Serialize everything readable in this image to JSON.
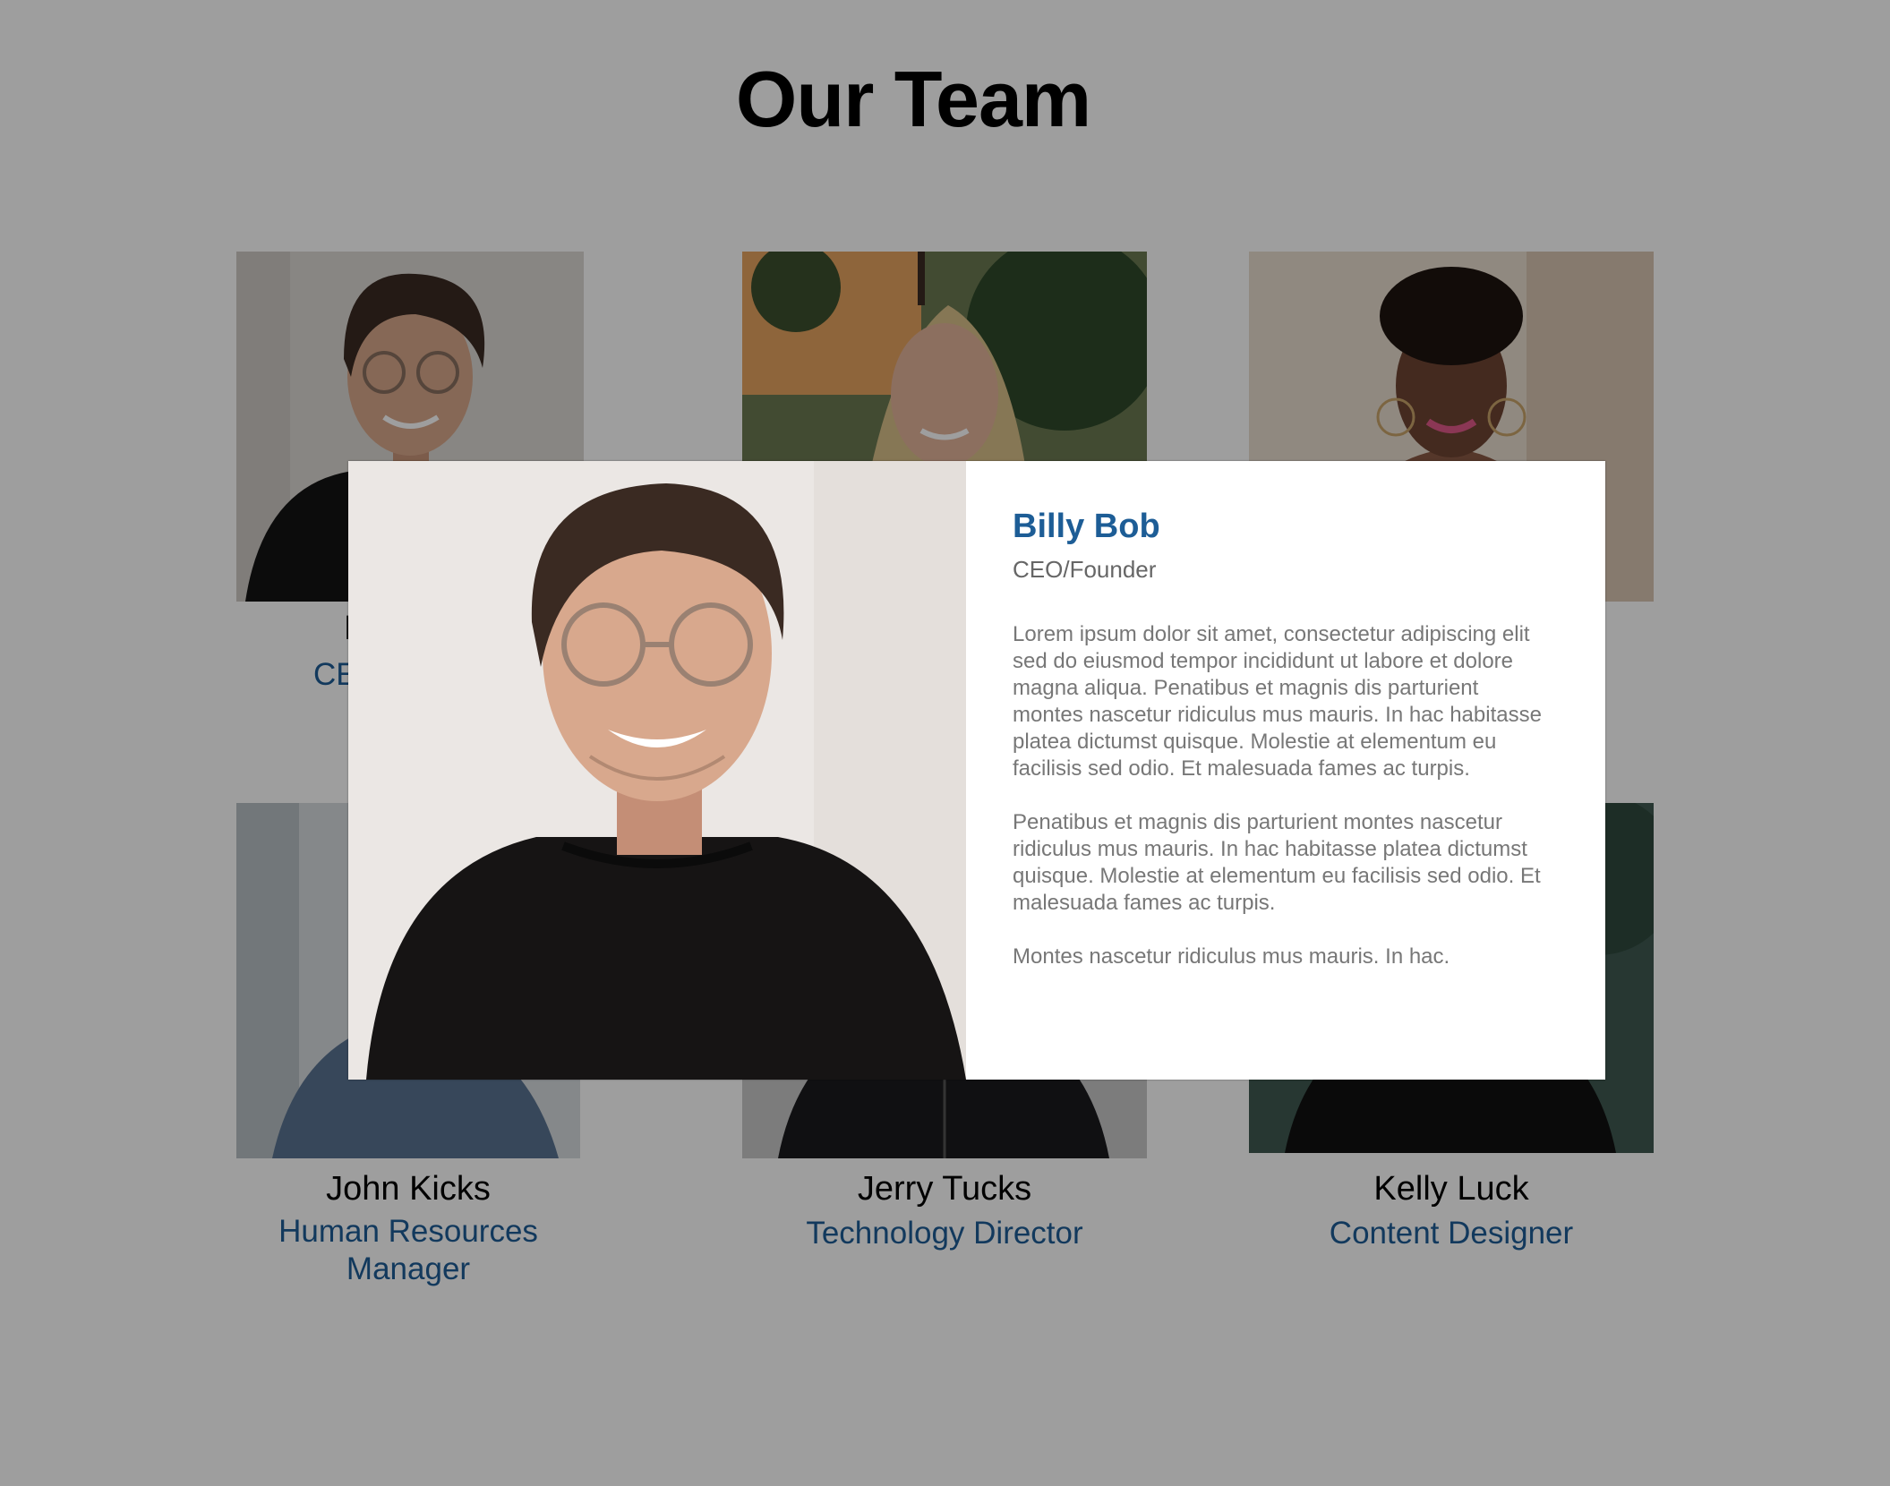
{
  "page": {
    "title": "Our Team"
  },
  "team": [
    {
      "name": "Billy Bob",
      "role": "CEO/Founder"
    },
    {
      "name": "",
      "role": ""
    },
    {
      "name": "",
      "role": ""
    },
    {
      "name": "John Kicks",
      "role": "Human Resources Manager"
    },
    {
      "name": "Jerry Tucks",
      "role": "Technology Director"
    },
    {
      "name": "Kelly Luck",
      "role": "Content Designer"
    }
  ],
  "modal": {
    "name": "Billy Bob",
    "role": "CEO/Founder",
    "bio": [
      "Lorem ipsum dolor sit amet, consectetur adipiscing elit sed do eiusmod tempor incididunt ut labore et dolore magna aliqua. Penatibus et magnis dis parturient montes nascetur ridiculus mus mauris. In hac habitasse platea dictumst quisque. Molestie at elementum eu facilisis sed odio. Et malesuada fames ac turpis.",
      "Penatibus et magnis dis parturient montes nascetur ridiculus mus mauris. In hac habitasse platea dictumst quisque. Molestie at elementum eu facilisis sed odio. Et malesuada fames ac turpis.",
      "Montes nascetur ridiculus mus mauris. In hac."
    ]
  }
}
